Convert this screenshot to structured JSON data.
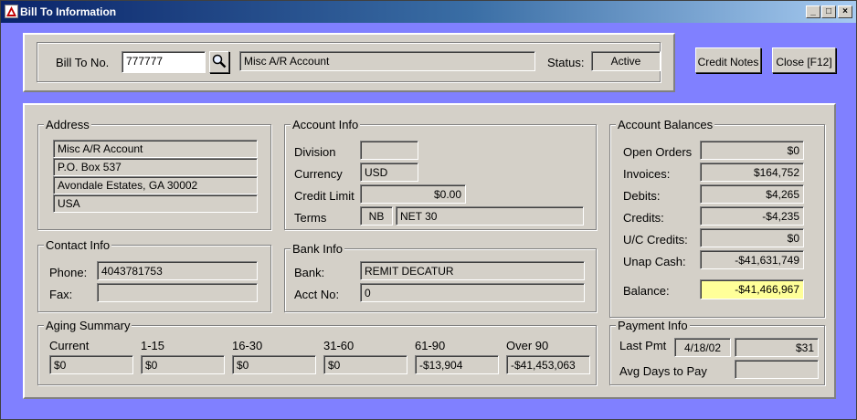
{
  "window": {
    "title": "Bill To Information",
    "minimize": "_",
    "maximize": "□",
    "close": "×"
  },
  "header": {
    "bill_to_label": "Bill To No.",
    "bill_to_value": "777777",
    "account_name": "Misc A/R Account",
    "status_label": "Status:",
    "status_value": "Active",
    "credit_notes_button": "Credit Notes",
    "close_button": "Close [F12]"
  },
  "address": {
    "title": "Address",
    "lines": [
      "Misc A/R Account",
      "P.O. Box 537",
      "Avondale Estates, GA  30002",
      "USA"
    ]
  },
  "account_info": {
    "title": "Account Info",
    "division_label": "Division",
    "division_value": "",
    "currency_label": "Currency",
    "currency_value": "USD",
    "credit_limit_label": "Credit Limit",
    "credit_limit_value": "$0.00",
    "terms_label": "Terms",
    "terms_code": "NB",
    "terms_desc": "NET 30"
  },
  "account_balances": {
    "title": "Account Balances",
    "rows": [
      {
        "label": "Open Orders",
        "value": "$0"
      },
      {
        "label": "Invoices:",
        "value": "$164,752"
      },
      {
        "label": "Debits:",
        "value": "$4,265"
      },
      {
        "label": "Credits:",
        "value": "-$4,235"
      },
      {
        "label": "U/C Credits:",
        "value": "$0"
      },
      {
        "label": "Unap Cash:",
        "value": "-$41,631,749"
      }
    ],
    "balance_label": "Balance:",
    "balance_value": "-$41,466,967"
  },
  "contact_info": {
    "title": "Contact Info",
    "phone_label": "Phone:",
    "phone_value": "4043781753",
    "fax_label": "Fax:",
    "fax_value": ""
  },
  "bank_info": {
    "title": "Bank Info",
    "bank_label": "Bank:",
    "bank_value": "REMIT DECATUR",
    "acct_label": "Acct No:",
    "acct_value": "0"
  },
  "aging_summary": {
    "title": "Aging Summary",
    "buckets": [
      {
        "label": "Current",
        "value": "$0"
      },
      {
        "label": "1-15",
        "value": "$0"
      },
      {
        "label": "16-30",
        "value": "$0"
      },
      {
        "label": "31-60",
        "value": "$0"
      },
      {
        "label": "61-90",
        "value": "-$13,904"
      },
      {
        "label": "Over 90",
        "value": "-$41,453,063"
      }
    ]
  },
  "payment_info": {
    "title": "Payment Info",
    "last_pmt_label": "Last Pmt",
    "last_pmt_date": "4/18/02",
    "last_pmt_amount": "$31",
    "avg_days_label": "Avg Days to Pay",
    "avg_days_value": ""
  }
}
